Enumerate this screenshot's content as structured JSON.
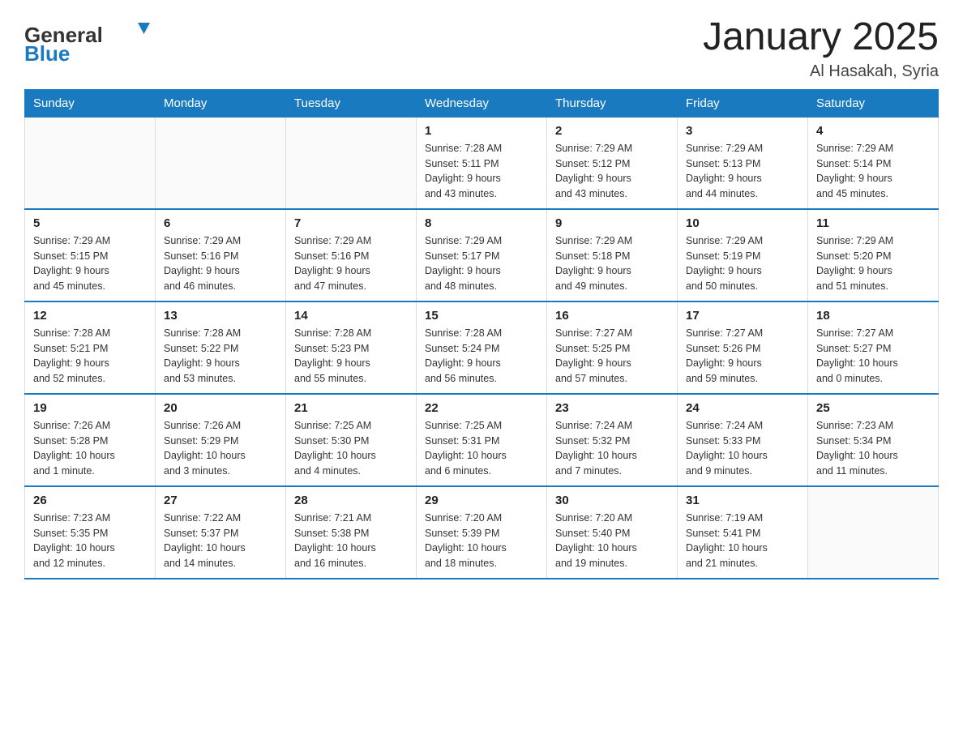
{
  "header": {
    "logo": {
      "general": "General",
      "blue": "Blue"
    },
    "title": "January 2025",
    "location": "Al Hasakah, Syria"
  },
  "weekdays": [
    "Sunday",
    "Monday",
    "Tuesday",
    "Wednesday",
    "Thursday",
    "Friday",
    "Saturday"
  ],
  "weeks": [
    [
      {
        "day": "",
        "info": ""
      },
      {
        "day": "",
        "info": ""
      },
      {
        "day": "",
        "info": ""
      },
      {
        "day": "1",
        "info": "Sunrise: 7:28 AM\nSunset: 5:11 PM\nDaylight: 9 hours\nand 43 minutes."
      },
      {
        "day": "2",
        "info": "Sunrise: 7:29 AM\nSunset: 5:12 PM\nDaylight: 9 hours\nand 43 minutes."
      },
      {
        "day": "3",
        "info": "Sunrise: 7:29 AM\nSunset: 5:13 PM\nDaylight: 9 hours\nand 44 minutes."
      },
      {
        "day": "4",
        "info": "Sunrise: 7:29 AM\nSunset: 5:14 PM\nDaylight: 9 hours\nand 45 minutes."
      }
    ],
    [
      {
        "day": "5",
        "info": "Sunrise: 7:29 AM\nSunset: 5:15 PM\nDaylight: 9 hours\nand 45 minutes."
      },
      {
        "day": "6",
        "info": "Sunrise: 7:29 AM\nSunset: 5:16 PM\nDaylight: 9 hours\nand 46 minutes."
      },
      {
        "day": "7",
        "info": "Sunrise: 7:29 AM\nSunset: 5:16 PM\nDaylight: 9 hours\nand 47 minutes."
      },
      {
        "day": "8",
        "info": "Sunrise: 7:29 AM\nSunset: 5:17 PM\nDaylight: 9 hours\nand 48 minutes."
      },
      {
        "day": "9",
        "info": "Sunrise: 7:29 AM\nSunset: 5:18 PM\nDaylight: 9 hours\nand 49 minutes."
      },
      {
        "day": "10",
        "info": "Sunrise: 7:29 AM\nSunset: 5:19 PM\nDaylight: 9 hours\nand 50 minutes."
      },
      {
        "day": "11",
        "info": "Sunrise: 7:29 AM\nSunset: 5:20 PM\nDaylight: 9 hours\nand 51 minutes."
      }
    ],
    [
      {
        "day": "12",
        "info": "Sunrise: 7:28 AM\nSunset: 5:21 PM\nDaylight: 9 hours\nand 52 minutes."
      },
      {
        "day": "13",
        "info": "Sunrise: 7:28 AM\nSunset: 5:22 PM\nDaylight: 9 hours\nand 53 minutes."
      },
      {
        "day": "14",
        "info": "Sunrise: 7:28 AM\nSunset: 5:23 PM\nDaylight: 9 hours\nand 55 minutes."
      },
      {
        "day": "15",
        "info": "Sunrise: 7:28 AM\nSunset: 5:24 PM\nDaylight: 9 hours\nand 56 minutes."
      },
      {
        "day": "16",
        "info": "Sunrise: 7:27 AM\nSunset: 5:25 PM\nDaylight: 9 hours\nand 57 minutes."
      },
      {
        "day": "17",
        "info": "Sunrise: 7:27 AM\nSunset: 5:26 PM\nDaylight: 9 hours\nand 59 minutes."
      },
      {
        "day": "18",
        "info": "Sunrise: 7:27 AM\nSunset: 5:27 PM\nDaylight: 10 hours\nand 0 minutes."
      }
    ],
    [
      {
        "day": "19",
        "info": "Sunrise: 7:26 AM\nSunset: 5:28 PM\nDaylight: 10 hours\nand 1 minute."
      },
      {
        "day": "20",
        "info": "Sunrise: 7:26 AM\nSunset: 5:29 PM\nDaylight: 10 hours\nand 3 minutes."
      },
      {
        "day": "21",
        "info": "Sunrise: 7:25 AM\nSunset: 5:30 PM\nDaylight: 10 hours\nand 4 minutes."
      },
      {
        "day": "22",
        "info": "Sunrise: 7:25 AM\nSunset: 5:31 PM\nDaylight: 10 hours\nand 6 minutes."
      },
      {
        "day": "23",
        "info": "Sunrise: 7:24 AM\nSunset: 5:32 PM\nDaylight: 10 hours\nand 7 minutes."
      },
      {
        "day": "24",
        "info": "Sunrise: 7:24 AM\nSunset: 5:33 PM\nDaylight: 10 hours\nand 9 minutes."
      },
      {
        "day": "25",
        "info": "Sunrise: 7:23 AM\nSunset: 5:34 PM\nDaylight: 10 hours\nand 11 minutes."
      }
    ],
    [
      {
        "day": "26",
        "info": "Sunrise: 7:23 AM\nSunset: 5:35 PM\nDaylight: 10 hours\nand 12 minutes."
      },
      {
        "day": "27",
        "info": "Sunrise: 7:22 AM\nSunset: 5:37 PM\nDaylight: 10 hours\nand 14 minutes."
      },
      {
        "day": "28",
        "info": "Sunrise: 7:21 AM\nSunset: 5:38 PM\nDaylight: 10 hours\nand 16 minutes."
      },
      {
        "day": "29",
        "info": "Sunrise: 7:20 AM\nSunset: 5:39 PM\nDaylight: 10 hours\nand 18 minutes."
      },
      {
        "day": "30",
        "info": "Sunrise: 7:20 AM\nSunset: 5:40 PM\nDaylight: 10 hours\nand 19 minutes."
      },
      {
        "day": "31",
        "info": "Sunrise: 7:19 AM\nSunset: 5:41 PM\nDaylight: 10 hours\nand 21 minutes."
      },
      {
        "day": "",
        "info": ""
      }
    ]
  ]
}
